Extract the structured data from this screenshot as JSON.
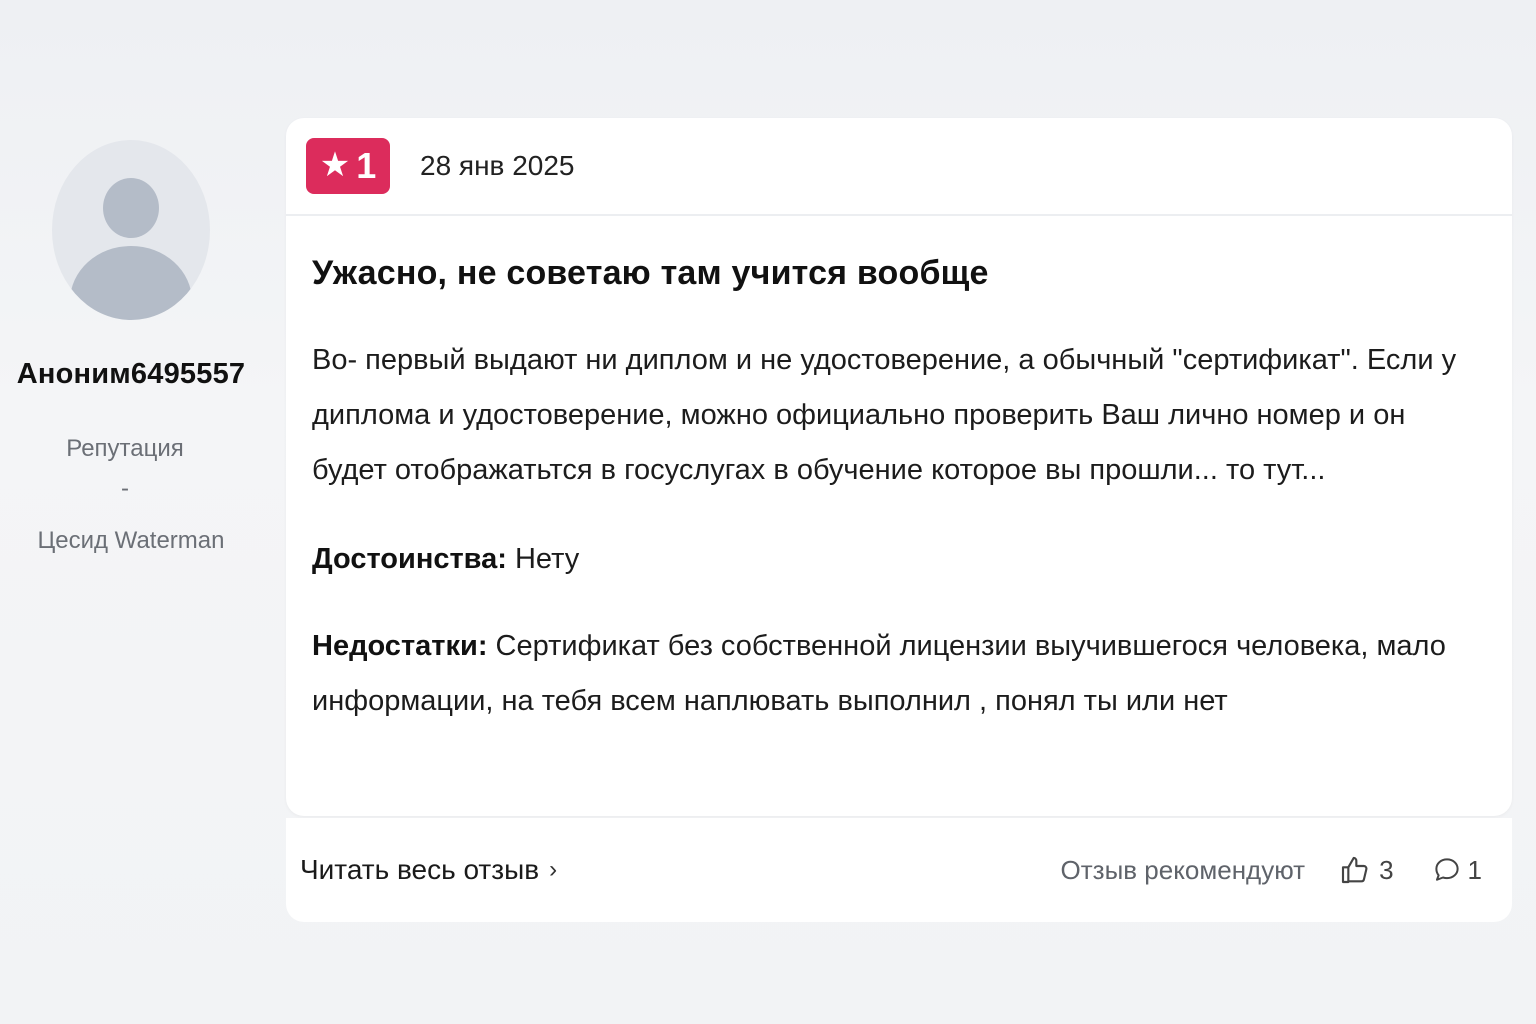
{
  "author": {
    "name": "Аноним6495557",
    "reputation_label": "Репутация",
    "reputation_value": "-",
    "city": "Цесид Waterman"
  },
  "review": {
    "rating": "1",
    "date": "28 янв 2025",
    "title": "Ужасно, не советаю там учится вообще",
    "text": "Во- первый выдают ни диплом и не удостоверение, а обычный  \"сертификат\". Если у диплома и удостоверение, можно официально проверить Ваш лично номер и он будет отображатьтся в госуслугах в обучение которое вы прошли... то тут...",
    "pros_label": "Достоинства:",
    "pros_text": "Нету",
    "cons_label": "Недостатки:",
    "cons_text": "Сертификат без собственной лицензии выучившегося человека, мало информации, на тебя всем наплювать выполнил , понял ты или нет"
  },
  "footer": {
    "read_more_label": "Читать весь отзыв",
    "recommend_label": "Отзыв рекомендуют",
    "likes_count": "3",
    "comments_count": "1"
  },
  "colors": {
    "rating_badge": "#dc2c5c",
    "background": "#f0f2f5",
    "card": "#ffffff"
  },
  "icons": {
    "rating": "star-icon",
    "read_more": "chevron-right-icon",
    "likes": "thumbs-up-icon",
    "comments": "comment-bubble-icon",
    "avatar": "user-placeholder-icon"
  }
}
